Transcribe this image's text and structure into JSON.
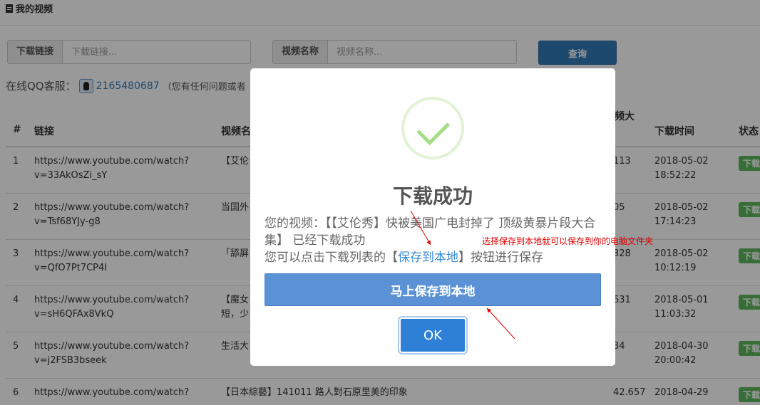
{
  "page": {
    "title": "我的视频"
  },
  "search": {
    "link_label": "下载链接",
    "link_placeholder": "下载链接...",
    "name_label": "视频名称",
    "name_placeholder": "视频名称...",
    "query_button": "查询"
  },
  "support": {
    "label": "在线QQ客服：",
    "qq_number": "2165480687",
    "note": "（您有任何问题或者"
  },
  "table": {
    "headers": {
      "index": "#",
      "link": "链接",
      "name": "视频名",
      "size": "频大",
      "time": "下载时间",
      "status": "状态"
    },
    "rows": [
      {
        "index": "1",
        "link1": "https://www.youtube.com/watch?",
        "link2": "v=33AkOsZi_sY",
        "name": "【艾伦",
        "size": "113",
        "time1": "2018-05-02",
        "time2": "18:52:22",
        "status": "下载"
      },
      {
        "index": "2",
        "link1": "https://www.youtube.com/watch?",
        "link2": "v=Tsf68YJy-g8",
        "name": "当国外",
        "size": "05",
        "time1": "2018-05-02",
        "time2": "17:14:23",
        "status": "下载"
      },
      {
        "index": "3",
        "link1": "https://www.youtube.com/watch?",
        "link2": "v=QfO7Pt7CP4I",
        "name": "「舔屏",
        "size": "328",
        "time1": "2018-05-02",
        "time2": "10:12:19",
        "status": "下载"
      },
      {
        "index": "4",
        "link1": "https://www.youtube.com/watch?",
        "link2": "v=sH6QFAx8VkQ",
        "name": "【魔女",
        "name2": "短，少",
        "size": "631",
        "time1": "2018-05-01",
        "time2": "11:03:32",
        "status": "下载"
      },
      {
        "index": "5",
        "link1": "https://www.youtube.com/watch?",
        "link2": "v=j2FSB3bseek",
        "name": "生活大",
        "size": "34",
        "time1": "2018-04-30",
        "time2": "20:00:42",
        "status": "下载"
      },
      {
        "index": "6",
        "link1": "https://www.youtube.com/watch?",
        "link2": "",
        "name": "【日本綜藝】141011 路人對石原里美的印象",
        "size": "42.657",
        "time1": "2018-04-29",
        "time2": "",
        "status": "下载"
      }
    ]
  },
  "modal": {
    "title": "下载成功",
    "msg_prefix": "您的视频：【【艾伦秀】快被美国广电封掉了 顶级黄暴片段大合集】 已经下载成功",
    "msg_line2_prefix": "您可以点击下载列表的【",
    "msg_link": "保存到本地",
    "msg_line2_suffix": "】按钮进行保存",
    "save_button": "马上保存到本地",
    "ok_button": "OK"
  },
  "annotation": {
    "text": "选择保存到本地就可以保存到你的电脑文件夹",
    "color": "#e00000"
  }
}
